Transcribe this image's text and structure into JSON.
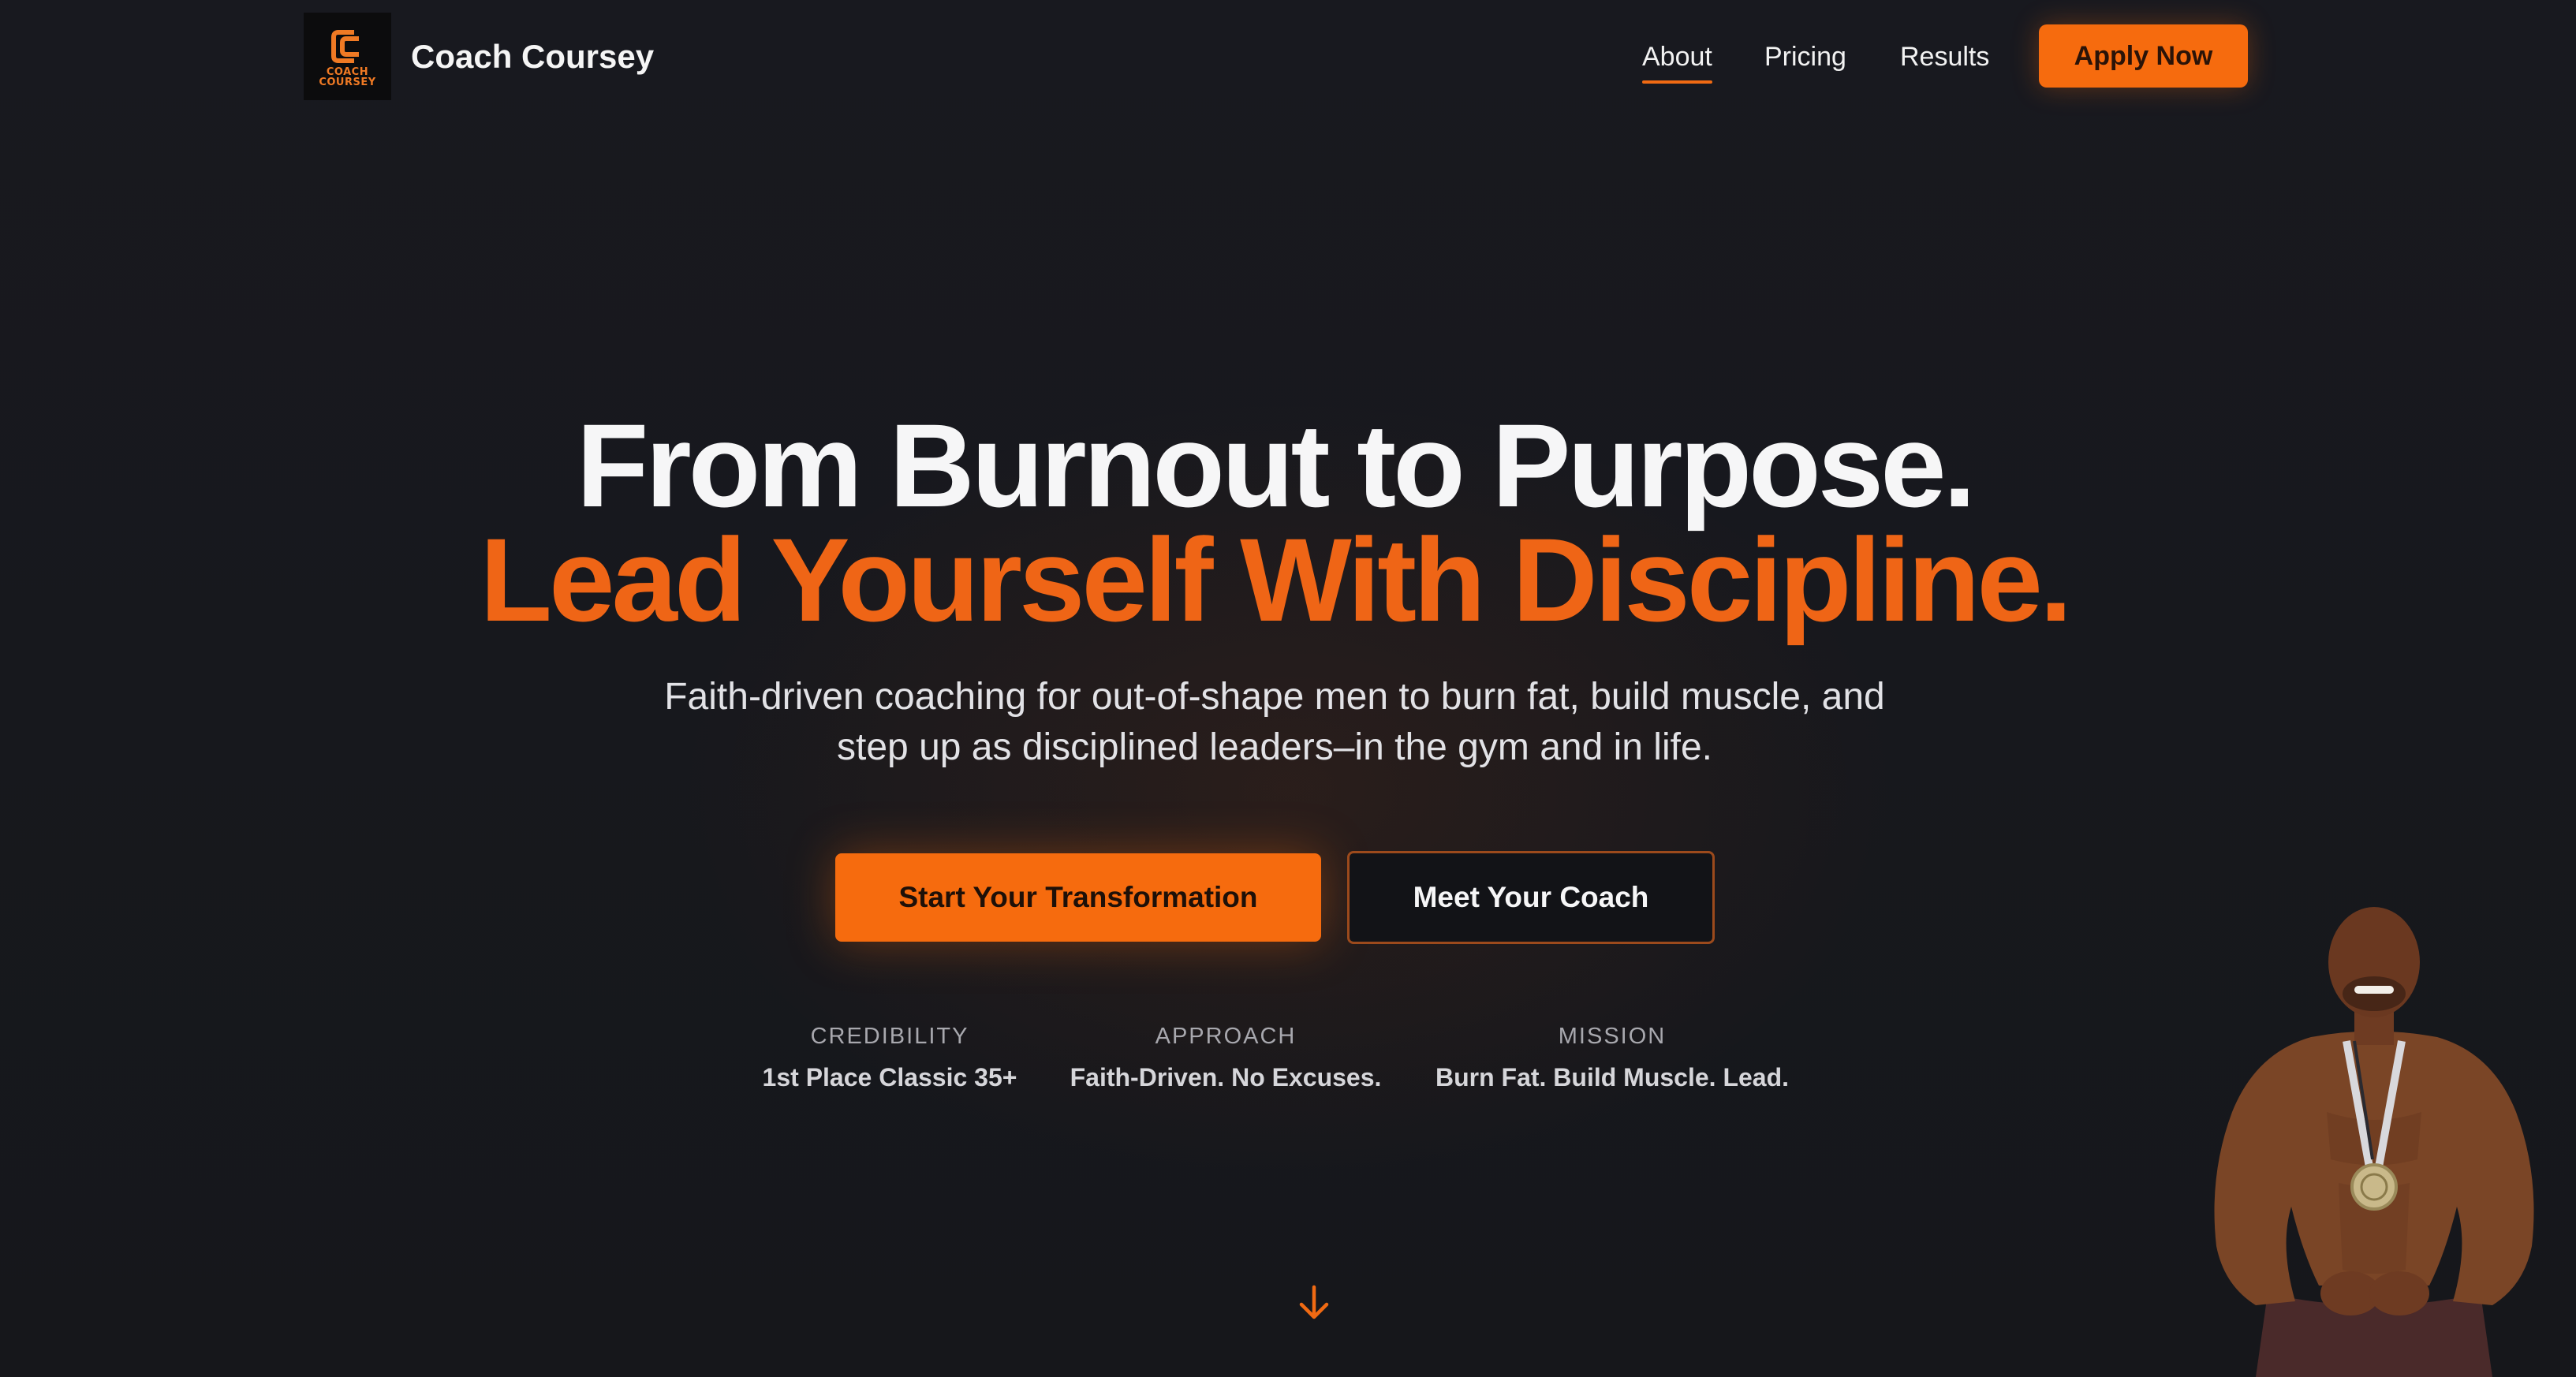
{
  "brand": {
    "name": "Coach Coursey",
    "logo_lines": [
      "COACH",
      "COURSEY"
    ],
    "logo_icon": "cc-monogram-icon"
  },
  "nav": {
    "items": [
      {
        "label": "About",
        "active": true
      },
      {
        "label": "Pricing",
        "active": false
      },
      {
        "label": "Results",
        "active": false
      }
    ],
    "cta_label": "Apply Now"
  },
  "hero": {
    "headline_line1": "From Burnout to Purpose.",
    "headline_line2": "Lead Yourself With Discipline.",
    "subtitle": "Faith-driven coaching for out-of-shape men to burn fat, build muscle, and step up as disciplined leaders–in the gym and in life.",
    "primary_button": "Start Your Transformation",
    "secondary_button": "Meet Your Coach"
  },
  "stats": [
    {
      "label": "CREDIBILITY",
      "value": "1st Place Classic 35+"
    },
    {
      "label": "APPROACH",
      "value": "Faith-Driven. No Excuses."
    },
    {
      "label": "MISSION",
      "value": "Burn Fat. Build Muscle. Lead."
    }
  ],
  "scroll_icon": "arrow-down-icon",
  "colors": {
    "background": "#16171c",
    "accent": "#f66b0e",
    "headline_accent": "#ef6516",
    "text": "#f6f6f7",
    "muted": "#a8a8ae"
  }
}
